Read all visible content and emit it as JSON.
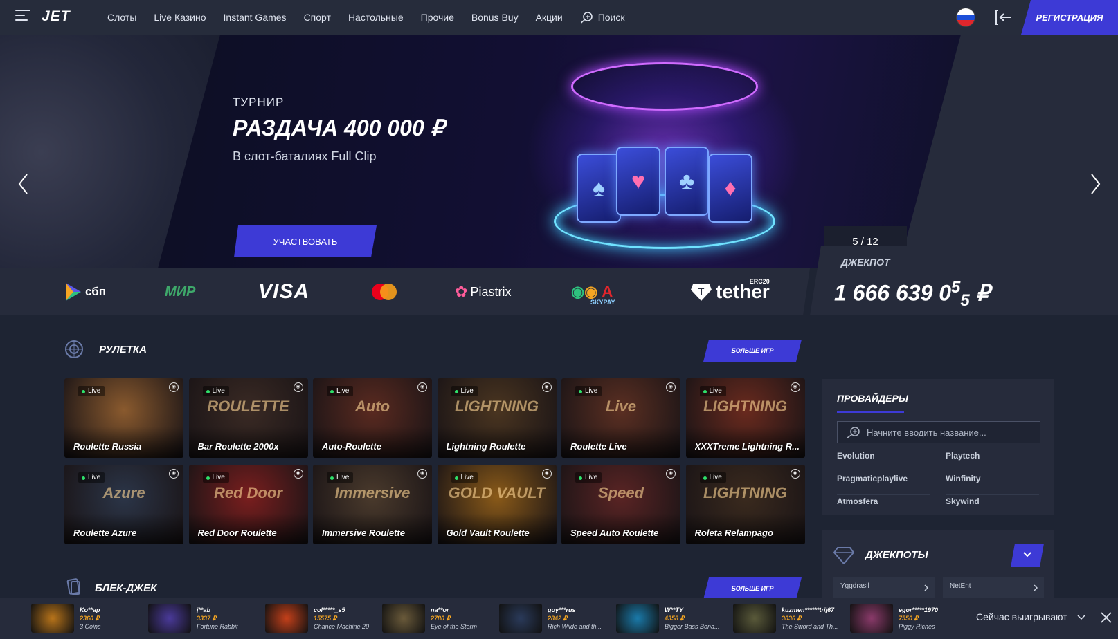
{
  "header": {
    "logo": "JET",
    "nav": [
      "Слоты",
      "Live Казино",
      "Instant Games",
      "Спорт",
      "Настольные",
      "Прочие",
      "Bonus Buy",
      "Акции"
    ],
    "search_label": "Поиск",
    "register_label": "РЕГИСТРАЦИЯ"
  },
  "banner": {
    "kicker": "ТУРНИР",
    "title": "РАЗДАЧА 400 000 ₽",
    "subtitle": "В слот-баталиях Full Clip",
    "cta": "УЧАСТВОВАТЬ",
    "counter": "5 / 12"
  },
  "payments": [
    "сбп",
    "МИР",
    "VISA",
    "mastercard",
    "Piastrix",
    "SKYPAY",
    "tether"
  ],
  "payments_extra": {
    "tether_tag": "ERC20"
  },
  "jackpot": {
    "label": "ДЖЕКПОТ",
    "value_main": "1 666 639 0",
    "value_sup": "5",
    "value_sub": "5",
    "currency": "₽"
  },
  "roulette": {
    "title": "РУЛЕТКА",
    "more": "БОЛЬШЕ ИГР",
    "live_label": "Live",
    "games": [
      {
        "name": "Roulette Russia",
        "deco": "",
        "color": "#8a5a2e"
      },
      {
        "name": "Bar Roulette 2000x",
        "deco": "ROULETTE",
        "color": "#3a2a24"
      },
      {
        "name": "Auto-Roulette",
        "deco": "Auto",
        "color": "#5a2a20"
      },
      {
        "name": "Lightning Roulette",
        "deco": "LIGHTNING",
        "color": "#4a3520"
      },
      {
        "name": "Roulette Live",
        "deco": "Live",
        "color": "#5b2f22"
      },
      {
        "name": "XXXTreme Lightning R...",
        "deco": "LIGHTNING",
        "color": "#6a2a1e"
      },
      {
        "name": "Roulette Azure",
        "deco": "Azure",
        "color": "#2b3548"
      },
      {
        "name": "Red Door Roulette",
        "deco": "Red Door",
        "color": "#7a1e1e"
      },
      {
        "name": "Immersive Roulette",
        "deco": "Immersive",
        "color": "#4a3a2c"
      },
      {
        "name": "Gold Vault Roulette",
        "deco": "GOLD VAULT",
        "color": "#8a5a18"
      },
      {
        "name": "Speed Auto Roulette",
        "deco": "Speed",
        "color": "#5a2424"
      },
      {
        "name": "Roleta Relampago",
        "deco": "LIGHTNING",
        "color": "#3a2a1e"
      }
    ]
  },
  "blackjack": {
    "title": "БЛЕК-ДЖЕК",
    "more": "БОЛЬШЕ ИГР"
  },
  "providers": {
    "title": "ПРОВАЙДЕРЫ",
    "placeholder": "Начните вводить название...",
    "items": [
      "Evolution",
      "Playtech",
      "Pragmaticplaylive",
      "Winfinity",
      "Atmosfera",
      "Skywind"
    ]
  },
  "jackpots": {
    "title": "ДЖЕКПОТЫ",
    "cards": [
      "Yggdrasil",
      "NetEnt"
    ]
  },
  "ticker": {
    "now_label": "Сейчас выигрывают",
    "wins": [
      {
        "user": "Ko**ap",
        "amount": "2360 ₽",
        "game": "3 Coins",
        "color": "#b8741a"
      },
      {
        "user": "j**ab",
        "amount": "3337 ₽",
        "game": "Fortune Rabbit",
        "color": "#4a3a9a"
      },
      {
        "user": "col*****_s5",
        "amount": "15575 ₽",
        "game": "Chance Machine 20",
        "color": "#c4401a"
      },
      {
        "user": "na**or",
        "amount": "2780 ₽",
        "game": "Eye of the Storm",
        "color": "#6a5a3a"
      },
      {
        "user": "goy***rus",
        "amount": "2842 ₽",
        "game": "Rich Wilde and th...",
        "color": "#2a3a5a"
      },
      {
        "user": "W**TY",
        "amount": "4358 ₽",
        "game": "Bigger Bass Bona...",
        "color": "#1a7aaa"
      },
      {
        "user": "kuzmen******trij67",
        "amount": "3036 ₽",
        "game": "The Sword and Th...",
        "color": "#5a5a3a"
      },
      {
        "user": "egor*****1970",
        "amount": "7550 ₽",
        "game": "Piggy Riches",
        "color": "#8a3a6a"
      }
    ]
  }
}
